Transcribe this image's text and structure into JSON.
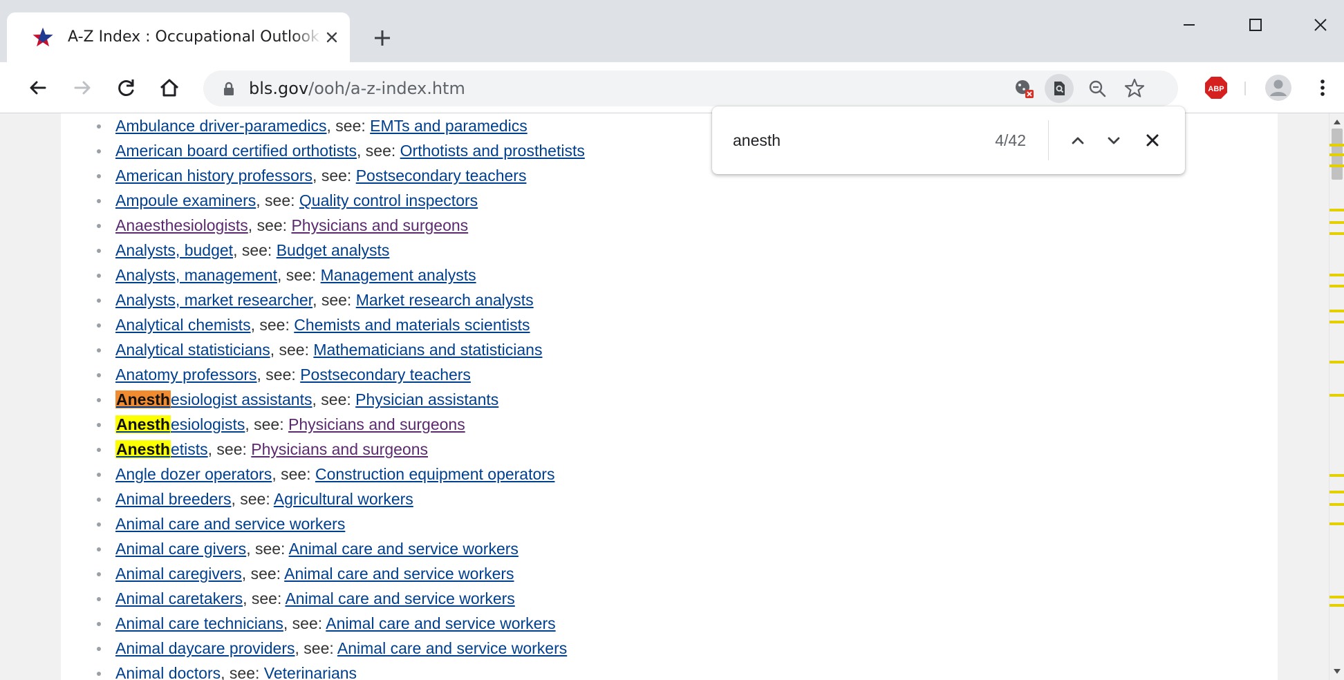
{
  "browser": {
    "tab": {
      "title": "A-Z Index : Occupational Outlook Handbook : : U.S. Bureau of Labor Statistics"
    },
    "address": {
      "domain": "bls.gov",
      "path": "/ooh/a-z-index.htm"
    }
  },
  "find": {
    "query": "anesth",
    "count": "4/42"
  },
  "colors": {
    "link": "#003f8d",
    "visited_link": "#5b2a6e",
    "match": "#fbff00",
    "active_match": "#f08b30",
    "scrollbar_mark": "#e4cf00"
  },
  "list": {
    "see_label": ", see: ",
    "items": [
      {
        "title": "Ambulance driver-paramedics",
        "see": "EMTs and paramedics"
      },
      {
        "title": "American board certified orthotists",
        "see": "Orthotists and prosthetists"
      },
      {
        "title": "American history professors",
        "see": "Postsecondary teachers"
      },
      {
        "title": "Ampoule examiners",
        "see": "Quality control inspectors"
      },
      {
        "title": "Anaesthesiologists",
        "see": "Physicians and surgeons"
      },
      {
        "title": "Analysts, budget",
        "see": "Budget analysts"
      },
      {
        "title": "Analysts, management",
        "see": "Management analysts"
      },
      {
        "title": "Analysts, market researcher",
        "see": "Market research analysts"
      },
      {
        "title": "Analytical chemists",
        "see": "Chemists and materials scientists"
      },
      {
        "title": "Analytical statisticians",
        "see": "Mathematicians and statisticians"
      },
      {
        "title": "Anatomy professors",
        "see": "Postsecondary teachers"
      },
      {
        "match": "Anesth",
        "title": "esiologist assistants",
        "see": "Physician assistants"
      },
      {
        "match": "Anesth",
        "title": "esiologists",
        "see": "Physicians and surgeons"
      },
      {
        "match": "Anesth",
        "title": "etists",
        "see": "Physicians and surgeons"
      },
      {
        "title": "Angle dozer operators",
        "see": "Construction equipment operators"
      },
      {
        "title": "Animal breeders",
        "see": "Agricultural workers"
      },
      {
        "title": "Animal care and service workers"
      },
      {
        "title": "Animal care givers",
        "see": "Animal care and service workers"
      },
      {
        "title": "Animal caregivers",
        "see": "Animal care and service workers"
      },
      {
        "title": "Animal caretakers",
        "see": "Animal care and service workers"
      },
      {
        "title": "Animal care technicians",
        "see": "Animal care and service workers"
      },
      {
        "title": "Animal daycare providers",
        "see": "Animal care and service workers"
      },
      {
        "title": "Animal doctors",
        "see": "Veterinarians"
      }
    ]
  }
}
